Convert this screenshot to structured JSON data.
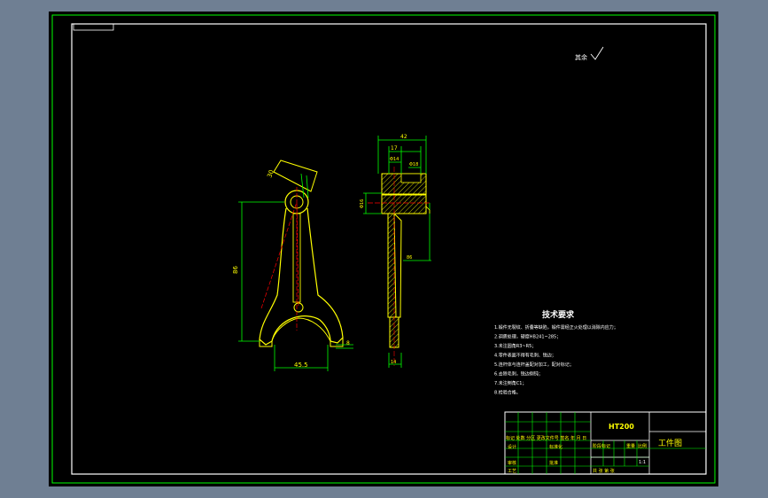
{
  "drawing": {
    "roughness_note": "其余",
    "tech_title": "技术要求",
    "tech_lines": [
      "1.锻件无裂纹、折叠等缺陷，锻件需经正火处理以消除内应力；",
      "2.调质处理，硬度HB241~285；",
      "3.未注圆角R3~R5；",
      "4.零件表面不得有毛刺、锐边；",
      "5.连杆体与连杆盖配对加工，配对标记；",
      "6.去除毛刺，锐边倒钝；",
      "7.未注倒角C1；",
      "8.检验合格。"
    ],
    "dims": {
      "top_width": "42",
      "d1": "17",
      "d2": "Φ14",
      "d3": "Φ18",
      "left_d": "Φ16",
      "mid_right": "86",
      "bottom_w": "14",
      "front_h": "86",
      "front_bottom": "45.5",
      "front_small": "8",
      "angle": "30"
    },
    "title_block": {
      "material": "HT200",
      "drawing_name": "工件图",
      "row_headers": "标记 处数 分区 更改文件号 签名 年 月 日",
      "design": "设计",
      "standard": "标准化",
      "review": "审核",
      "approve": "批准",
      "process": "工艺",
      "stage_label": "阶段标记",
      "weight_label": "重量",
      "scale_label": "比例",
      "scale_value": "1:1",
      "sheets": "共  张  第  张"
    }
  }
}
